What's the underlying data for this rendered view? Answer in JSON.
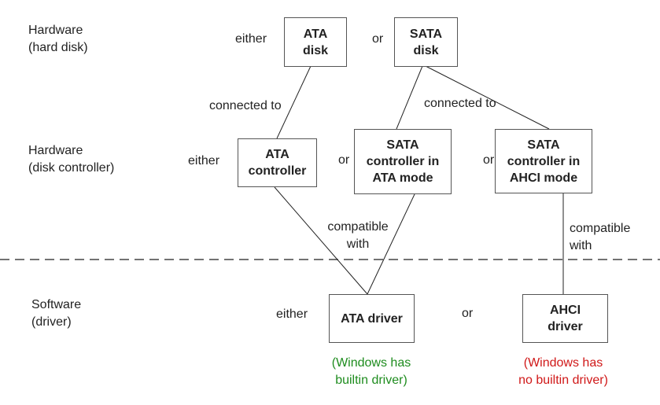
{
  "levels": {
    "disk": {
      "line1": "Hardware",
      "line2": "(hard disk)"
    },
    "controller": {
      "line1": "Hardware",
      "line2": "(disk controller)"
    },
    "driver": {
      "line1": "Software",
      "line2": "(driver)"
    }
  },
  "boxes": {
    "ata_disk": "ATA\ndisk",
    "sata_disk": "SATA\ndisk",
    "ata_controller": "ATA\ncontroller",
    "sata_ata_mode": "SATA\ncontroller in\nATA mode",
    "sata_ahci_mode": "SATA\ncontroller in\nAHCI mode",
    "ata_driver": "ATA driver",
    "ahci_driver": "AHCI\ndriver"
  },
  "connectors": {
    "either": "either",
    "or": "or",
    "connected_to": "connected to",
    "compatible_1": "compatible",
    "compatible_2": "with"
  },
  "notes": {
    "ata": {
      "line1": "(Windows has",
      "line2": "builtin driver)",
      "color": "#1e8c1e"
    },
    "ahci": {
      "line1": "(Windows has",
      "line2": "no builtin driver)",
      "color": "#d01818"
    }
  }
}
